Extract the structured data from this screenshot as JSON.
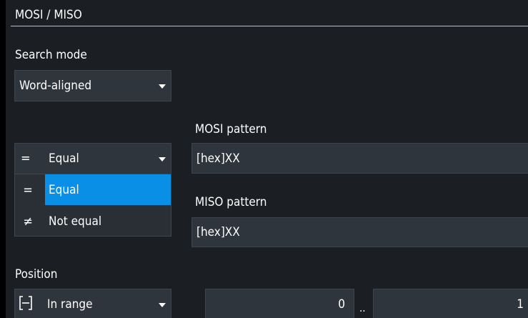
{
  "header": {
    "title": "MOSI / MISO"
  },
  "search_mode": {
    "label": "Search mode",
    "value": "Word-aligned"
  },
  "condition": {
    "symbol": "=",
    "value": "Equal",
    "options": [
      {
        "symbol": "=",
        "label": "Equal",
        "selected": true
      },
      {
        "symbol": "≠",
        "label": "Not equal",
        "selected": false
      }
    ]
  },
  "mosi": {
    "label": "MOSI pattern",
    "value": "[hex]XX"
  },
  "miso": {
    "label": "MISO pattern",
    "value": "[hex]XX"
  },
  "position": {
    "label": "Position",
    "mode": "In range",
    "from": "0",
    "separator": "..",
    "to": "1"
  },
  "colors": {
    "background": "#1b1f24",
    "field": "#2f353c",
    "accent": "#0a8fe6"
  }
}
